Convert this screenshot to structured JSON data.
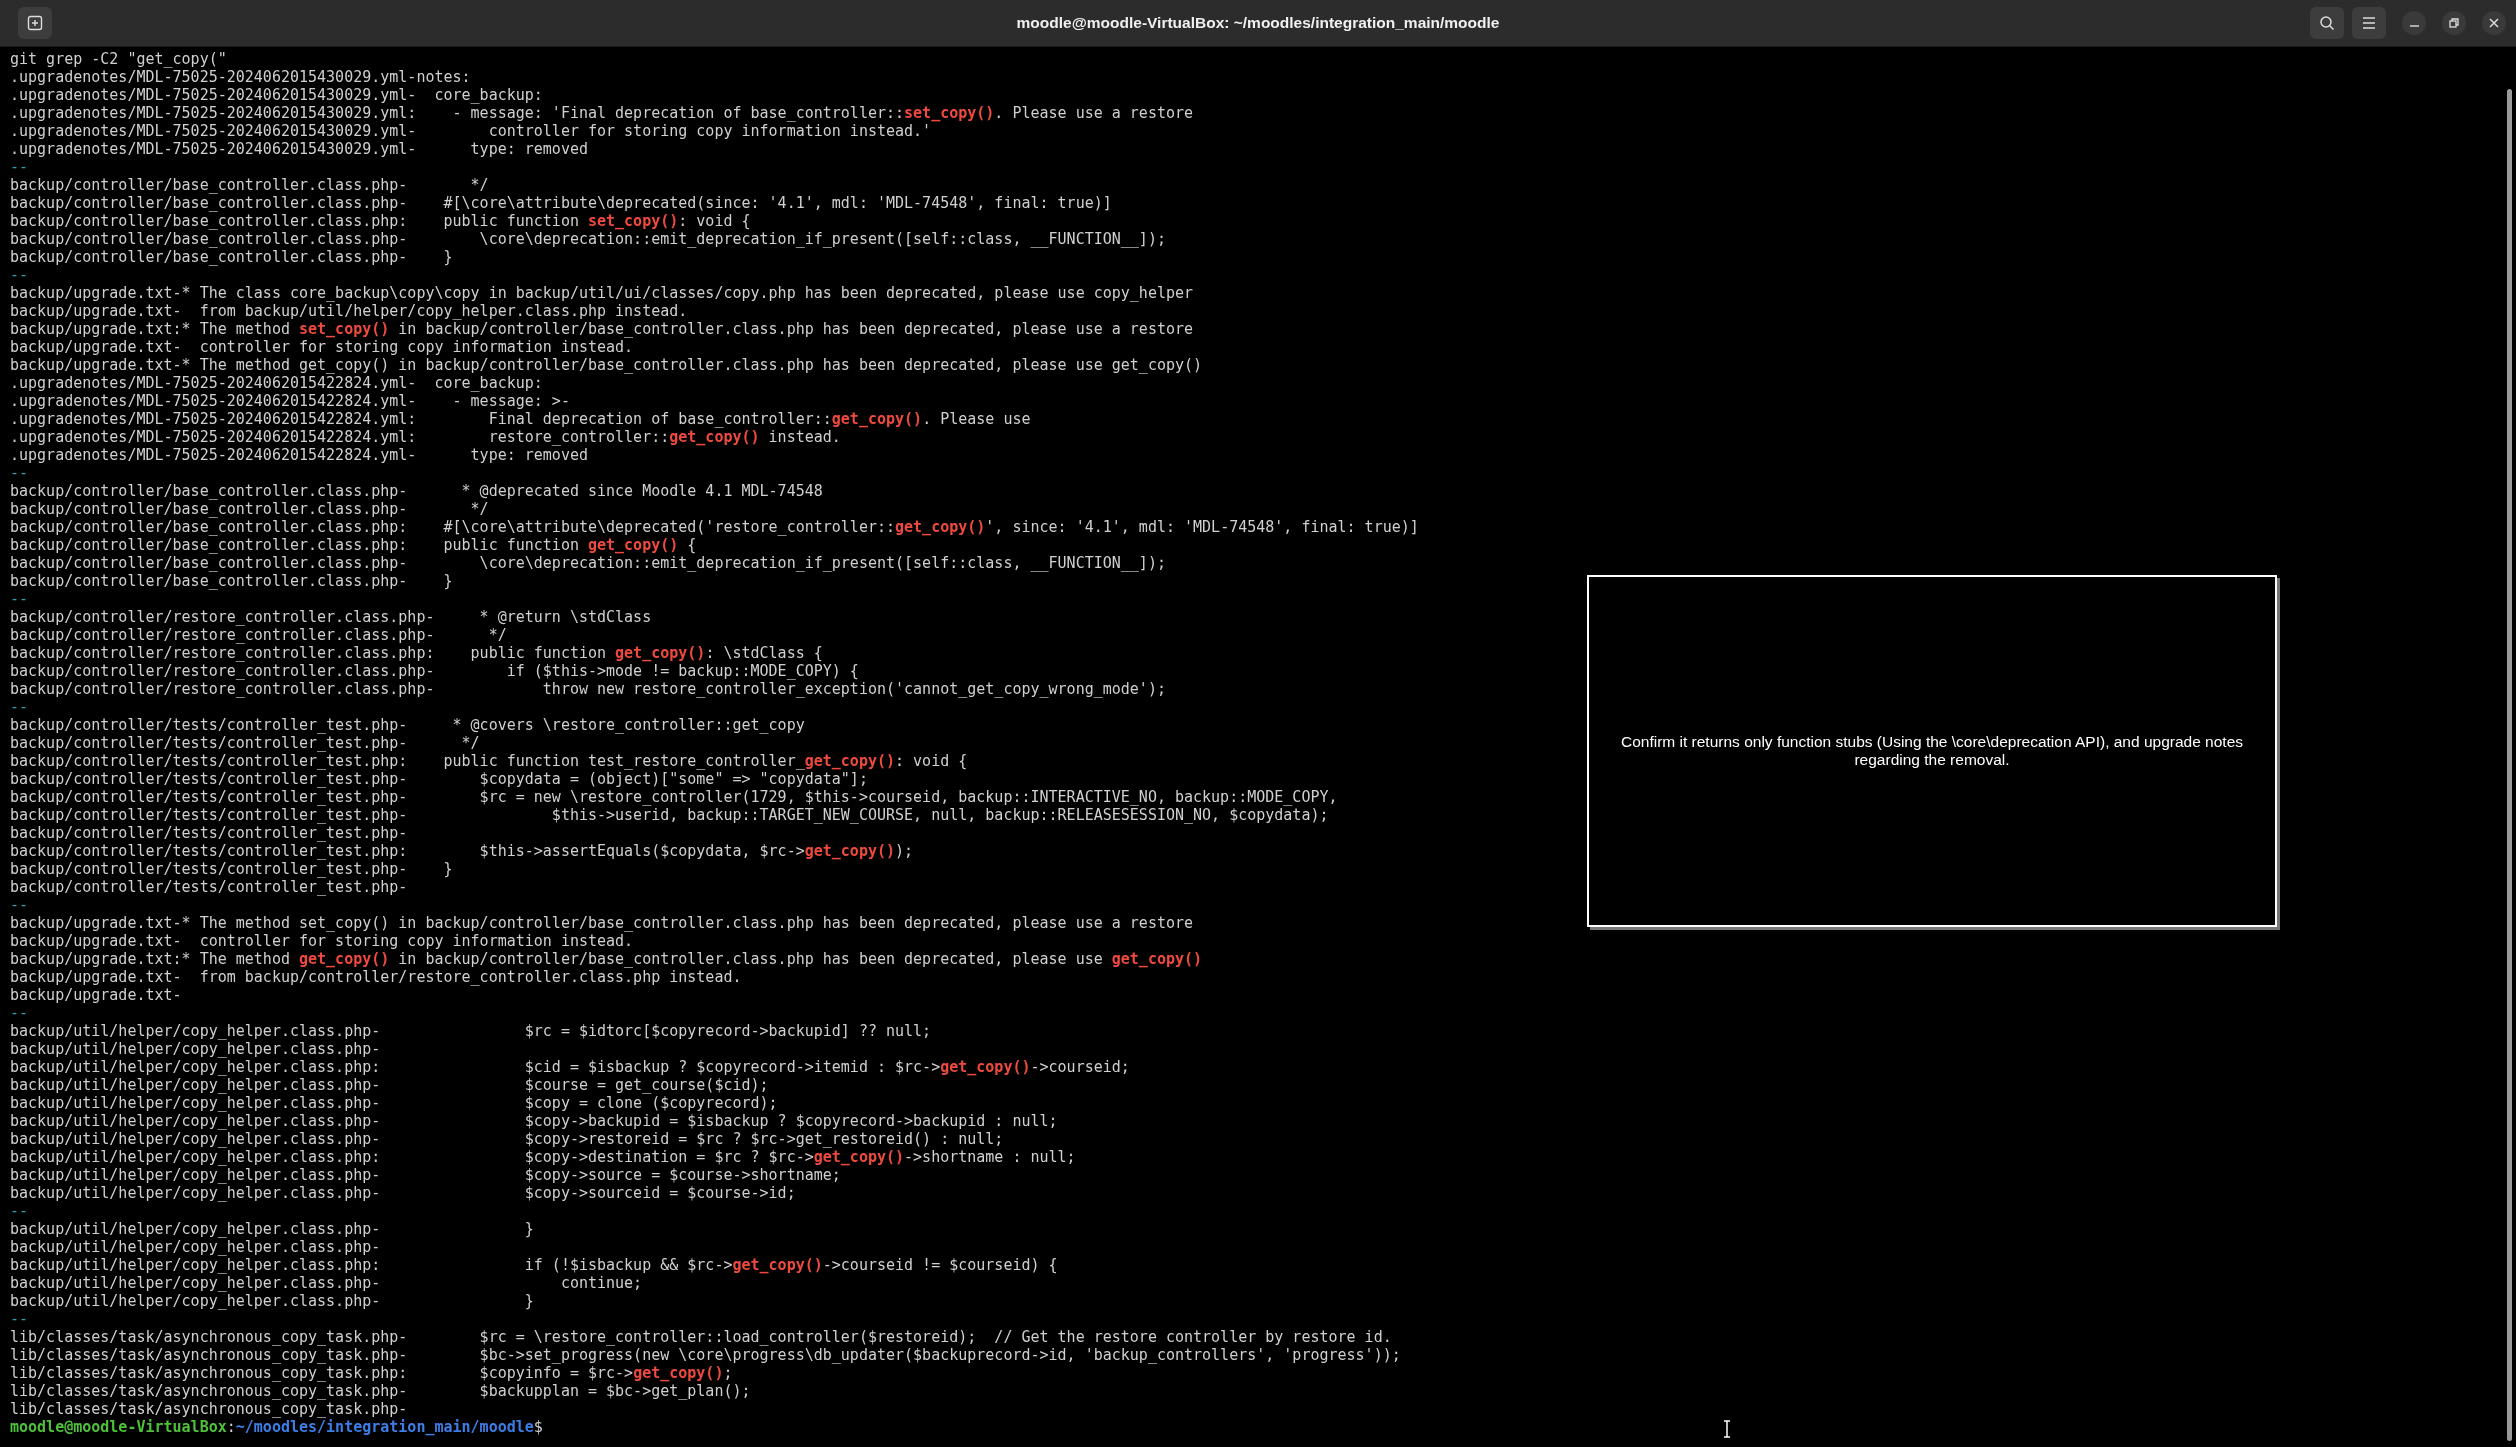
{
  "window": {
    "title": "moodle@moodle-VirtualBox: ~/moodles/integration_main/moodle"
  },
  "terminal": {
    "lines": [
      {
        "kind": "command",
        "segments": [
          {
            "kind": "plain",
            "text": "git grep -C2 \"get_copy(\""
          }
        ]
      },
      {
        "kind": "context",
        "segments": [
          {
            "kind": "plain",
            "text": ".upgradenotes/MDL-75025-2024062015430029.yml-notes:"
          }
        ]
      },
      {
        "kind": "context",
        "segments": [
          {
            "kind": "plain",
            "text": ".upgradenotes/MDL-75025-2024062015430029.yml-  core_backup:"
          }
        ]
      },
      {
        "kind": "match",
        "segments": [
          {
            "kind": "plain",
            "text": ".upgradenotes/MDL-75025-2024062015430029.yml:    - message: 'Final deprecation of base_controller::"
          },
          {
            "kind": "match",
            "text": "set_copy()"
          },
          {
            "kind": "plain",
            "text": ". Please use a restore"
          }
        ]
      },
      {
        "kind": "context",
        "segments": [
          {
            "kind": "plain",
            "text": ".upgradenotes/MDL-75025-2024062015430029.yml-        controller for storing copy information instead.'"
          }
        ]
      },
      {
        "kind": "context",
        "segments": [
          {
            "kind": "plain",
            "text": ".upgradenotes/MDL-75025-2024062015430029.yml-      type: removed"
          }
        ]
      },
      {
        "kind": "break",
        "segments": [
          {
            "kind": "plain",
            "text": "--"
          }
        ]
      },
      {
        "kind": "context",
        "segments": [
          {
            "kind": "plain",
            "text": "backup/controller/base_controller.class.php-       */"
          }
        ]
      },
      {
        "kind": "context",
        "segments": [
          {
            "kind": "plain",
            "text": "backup/controller/base_controller.class.php-    #[\\core\\attribute\\deprecated(since: '4.1', mdl: 'MDL-74548', final: true)]"
          }
        ]
      },
      {
        "kind": "match",
        "segments": [
          {
            "kind": "plain",
            "text": "backup/controller/base_controller.class.php:    public function "
          },
          {
            "kind": "match",
            "text": "set_copy()"
          },
          {
            "kind": "plain",
            "text": ": void {"
          }
        ]
      },
      {
        "kind": "context",
        "segments": [
          {
            "kind": "plain",
            "text": "backup/controller/base_controller.class.php-        \\core\\deprecation::emit_deprecation_if_present([self::class, __FUNCTION__]);"
          }
        ]
      },
      {
        "kind": "context",
        "segments": [
          {
            "kind": "plain",
            "text": "backup/controller/base_controller.class.php-    }"
          }
        ]
      },
      {
        "kind": "break",
        "segments": [
          {
            "kind": "plain",
            "text": "--"
          }
        ]
      },
      {
        "kind": "context",
        "segments": [
          {
            "kind": "plain",
            "text": "backup/upgrade.txt-* The class core_backup\\copy\\copy in backup/util/ui/classes/copy.php has been deprecated, please use copy_helper"
          }
        ]
      },
      {
        "kind": "context",
        "segments": [
          {
            "kind": "plain",
            "text": "backup/upgrade.txt-  from backup/util/helper/copy_helper.class.php instead."
          }
        ]
      },
      {
        "kind": "match",
        "segments": [
          {
            "kind": "plain",
            "text": "backup/upgrade.txt:* The method "
          },
          {
            "kind": "match",
            "text": "set_copy()"
          },
          {
            "kind": "plain",
            "text": " in backup/controller/base_controller.class.php has been deprecated, please use a restore"
          }
        ]
      },
      {
        "kind": "context",
        "segments": [
          {
            "kind": "plain",
            "text": "backup/upgrade.txt-  controller for storing copy information instead."
          }
        ]
      },
      {
        "kind": "context",
        "segments": [
          {
            "kind": "plain",
            "text": "backup/upgrade.txt-* The method get_copy() in backup/controller/base_controller.class.php has been deprecated, please use get_copy()"
          }
        ]
      },
      {
        "kind": "context",
        "segments": [
          {
            "kind": "plain",
            "text": ".upgradenotes/MDL-75025-2024062015422824.yml-  core_backup:"
          }
        ]
      },
      {
        "kind": "context",
        "segments": [
          {
            "kind": "plain",
            "text": ".upgradenotes/MDL-75025-2024062015422824.yml-    - message: >-"
          }
        ]
      },
      {
        "kind": "match",
        "segments": [
          {
            "kind": "plain",
            "text": ".upgradenotes/MDL-75025-2024062015422824.yml:        Final deprecation of base_controller::"
          },
          {
            "kind": "match",
            "text": "get_copy()"
          },
          {
            "kind": "plain",
            "text": ". Please use"
          }
        ]
      },
      {
        "kind": "match",
        "segments": [
          {
            "kind": "plain",
            "text": ".upgradenotes/MDL-75025-2024062015422824.yml:        restore_controller::"
          },
          {
            "kind": "match",
            "text": "get_copy()"
          },
          {
            "kind": "plain",
            "text": " instead."
          }
        ]
      },
      {
        "kind": "context",
        "segments": [
          {
            "kind": "plain",
            "text": ".upgradenotes/MDL-75025-2024062015422824.yml-      type: removed"
          }
        ]
      },
      {
        "kind": "break",
        "segments": [
          {
            "kind": "plain",
            "text": "--"
          }
        ]
      },
      {
        "kind": "context",
        "segments": [
          {
            "kind": "plain",
            "text": "backup/controller/base_controller.class.php-      * @deprecated since Moodle 4.1 MDL-74548"
          }
        ]
      },
      {
        "kind": "context",
        "segments": [
          {
            "kind": "plain",
            "text": "backup/controller/base_controller.class.php-       */"
          }
        ]
      },
      {
        "kind": "match",
        "segments": [
          {
            "kind": "plain",
            "text": "backup/controller/base_controller.class.php:    #[\\core\\attribute\\deprecated('restore_controller::"
          },
          {
            "kind": "match",
            "text": "get_copy()"
          },
          {
            "kind": "plain",
            "text": "', since: '4.1', mdl: 'MDL-74548', final: true)]"
          }
        ]
      },
      {
        "kind": "match",
        "segments": [
          {
            "kind": "plain",
            "text": "backup/controller/base_controller.class.php:    public function "
          },
          {
            "kind": "match",
            "text": "get_copy()"
          },
          {
            "kind": "plain",
            "text": " {"
          }
        ]
      },
      {
        "kind": "context",
        "segments": [
          {
            "kind": "plain",
            "text": "backup/controller/base_controller.class.php-        \\core\\deprecation::emit_deprecation_if_present([self::class, __FUNCTION__]);"
          }
        ]
      },
      {
        "kind": "context",
        "segments": [
          {
            "kind": "plain",
            "text": "backup/controller/base_controller.class.php-    }"
          }
        ]
      },
      {
        "kind": "break",
        "segments": [
          {
            "kind": "plain",
            "text": "--"
          }
        ]
      },
      {
        "kind": "context",
        "segments": [
          {
            "kind": "plain",
            "text": "backup/controller/restore_controller.class.php-     * @return \\stdClass"
          }
        ]
      },
      {
        "kind": "context",
        "segments": [
          {
            "kind": "plain",
            "text": "backup/controller/restore_controller.class.php-      */"
          }
        ]
      },
      {
        "kind": "match",
        "segments": [
          {
            "kind": "plain",
            "text": "backup/controller/restore_controller.class.php:    public function "
          },
          {
            "kind": "match",
            "text": "get_copy()"
          },
          {
            "kind": "plain",
            "text": ": \\stdClass {"
          }
        ]
      },
      {
        "kind": "context",
        "segments": [
          {
            "kind": "plain",
            "text": "backup/controller/restore_controller.class.php-        if ($this->mode != backup::MODE_COPY) {"
          }
        ]
      },
      {
        "kind": "context",
        "segments": [
          {
            "kind": "plain",
            "text": "backup/controller/restore_controller.class.php-            throw new restore_controller_exception('cannot_get_copy_wrong_mode');"
          }
        ]
      },
      {
        "kind": "break",
        "segments": [
          {
            "kind": "plain",
            "text": "--"
          }
        ]
      },
      {
        "kind": "context",
        "segments": [
          {
            "kind": "plain",
            "text": "backup/controller/tests/controller_test.php-     * @covers \\restore_controller::get_copy"
          }
        ]
      },
      {
        "kind": "context",
        "segments": [
          {
            "kind": "plain",
            "text": "backup/controller/tests/controller_test.php-      */"
          }
        ]
      },
      {
        "kind": "match",
        "segments": [
          {
            "kind": "plain",
            "text": "backup/controller/tests/controller_test.php:    public function test_restore_controller_"
          },
          {
            "kind": "match",
            "text": "get_copy()"
          },
          {
            "kind": "plain",
            "text": ": void {"
          }
        ]
      },
      {
        "kind": "context",
        "segments": [
          {
            "kind": "plain",
            "text": "backup/controller/tests/controller_test.php-        $copydata = (object)[\"some\" => \"copydata\"];"
          }
        ]
      },
      {
        "kind": "context",
        "segments": [
          {
            "kind": "plain",
            "text": "backup/controller/tests/controller_test.php-        $rc = new \\restore_controller(1729, $this->courseid, backup::INTERACTIVE_NO, backup::MODE_COPY,"
          }
        ]
      },
      {
        "kind": "context",
        "segments": [
          {
            "kind": "plain",
            "text": "backup/controller/tests/controller_test.php-                $this->userid, backup::TARGET_NEW_COURSE, null, backup::RELEASESESSION_NO, $copydata);"
          }
        ]
      },
      {
        "kind": "context",
        "segments": [
          {
            "kind": "plain",
            "text": "backup/controller/tests/controller_test.php-"
          }
        ]
      },
      {
        "kind": "match",
        "segments": [
          {
            "kind": "plain",
            "text": "backup/controller/tests/controller_test.php:        $this->assertEquals($copydata, $rc->"
          },
          {
            "kind": "match",
            "text": "get_copy()"
          },
          {
            "kind": "plain",
            "text": ");"
          }
        ]
      },
      {
        "kind": "context",
        "segments": [
          {
            "kind": "plain",
            "text": "backup/controller/tests/controller_test.php-    }"
          }
        ]
      },
      {
        "kind": "context",
        "segments": [
          {
            "kind": "plain",
            "text": "backup/controller/tests/controller_test.php-"
          }
        ]
      },
      {
        "kind": "break",
        "segments": [
          {
            "kind": "plain",
            "text": "--"
          }
        ]
      },
      {
        "kind": "context",
        "segments": [
          {
            "kind": "plain",
            "text": "backup/upgrade.txt-* The method set_copy() in backup/controller/base_controller.class.php has been deprecated, please use a restore"
          }
        ]
      },
      {
        "kind": "context",
        "segments": [
          {
            "kind": "plain",
            "text": "backup/upgrade.txt-  controller for storing copy information instead."
          }
        ]
      },
      {
        "kind": "match",
        "segments": [
          {
            "kind": "plain",
            "text": "backup/upgrade.txt:* The method "
          },
          {
            "kind": "match",
            "text": "get_copy()"
          },
          {
            "kind": "plain",
            "text": " in backup/controller/base_controller.class.php has been deprecated, please use "
          },
          {
            "kind": "match",
            "text": "get_copy()"
          }
        ]
      },
      {
        "kind": "context",
        "segments": [
          {
            "kind": "plain",
            "text": "backup/upgrade.txt-  from backup/controller/restore_controller.class.php instead."
          }
        ]
      },
      {
        "kind": "context",
        "segments": [
          {
            "kind": "plain",
            "text": "backup/upgrade.txt-"
          }
        ]
      },
      {
        "kind": "break",
        "segments": [
          {
            "kind": "plain",
            "text": "--"
          }
        ]
      },
      {
        "kind": "context",
        "segments": [
          {
            "kind": "plain",
            "text": "backup/util/helper/copy_helper.class.php-                $rc = $idtorc[$copyrecord->backupid] ?? null;"
          }
        ]
      },
      {
        "kind": "context",
        "segments": [
          {
            "kind": "plain",
            "text": "backup/util/helper/copy_helper.class.php-"
          }
        ]
      },
      {
        "kind": "match",
        "segments": [
          {
            "kind": "plain",
            "text": "backup/util/helper/copy_helper.class.php:                $cid = $isbackup ? $copyrecord->itemid : $rc->"
          },
          {
            "kind": "match",
            "text": "get_copy()"
          },
          {
            "kind": "plain",
            "text": "->courseid;"
          }
        ]
      },
      {
        "kind": "context",
        "segments": [
          {
            "kind": "plain",
            "text": "backup/util/helper/copy_helper.class.php-                $course = get_course($cid);"
          }
        ]
      },
      {
        "kind": "context",
        "segments": [
          {
            "kind": "plain",
            "text": "backup/util/helper/copy_helper.class.php-                $copy = clone ($copyrecord);"
          }
        ]
      },
      {
        "kind": "context",
        "segments": [
          {
            "kind": "plain",
            "text": "backup/util/helper/copy_helper.class.php-                $copy->backupid = $isbackup ? $copyrecord->backupid : null;"
          }
        ]
      },
      {
        "kind": "context",
        "segments": [
          {
            "kind": "plain",
            "text": "backup/util/helper/copy_helper.class.php-                $copy->restoreid = $rc ? $rc->get_restoreid() : null;"
          }
        ]
      },
      {
        "kind": "match",
        "segments": [
          {
            "kind": "plain",
            "text": "backup/util/helper/copy_helper.class.php:                $copy->destination = $rc ? $rc->"
          },
          {
            "kind": "match",
            "text": "get_copy()"
          },
          {
            "kind": "plain",
            "text": "->shortname : null;"
          }
        ]
      },
      {
        "kind": "context",
        "segments": [
          {
            "kind": "plain",
            "text": "backup/util/helper/copy_helper.class.php-                $copy->source = $course->shortname;"
          }
        ]
      },
      {
        "kind": "context",
        "segments": [
          {
            "kind": "plain",
            "text": "backup/util/helper/copy_helper.class.php-                $copy->sourceid = $course->id;"
          }
        ]
      },
      {
        "kind": "break",
        "segments": [
          {
            "kind": "plain",
            "text": "--"
          }
        ]
      },
      {
        "kind": "context",
        "segments": [
          {
            "kind": "plain",
            "text": "backup/util/helper/copy_helper.class.php-                }"
          }
        ]
      },
      {
        "kind": "context",
        "segments": [
          {
            "kind": "plain",
            "text": "backup/util/helper/copy_helper.class.php-"
          }
        ]
      },
      {
        "kind": "match",
        "segments": [
          {
            "kind": "plain",
            "text": "backup/util/helper/copy_helper.class.php:                if (!$isbackup && $rc->"
          },
          {
            "kind": "match",
            "text": "get_copy()"
          },
          {
            "kind": "plain",
            "text": "->courseid != $courseid) {"
          }
        ]
      },
      {
        "kind": "context",
        "segments": [
          {
            "kind": "plain",
            "text": "backup/util/helper/copy_helper.class.php-                    continue;"
          }
        ]
      },
      {
        "kind": "context",
        "segments": [
          {
            "kind": "plain",
            "text": "backup/util/helper/copy_helper.class.php-                }"
          }
        ]
      },
      {
        "kind": "break",
        "segments": [
          {
            "kind": "plain",
            "text": "--"
          }
        ]
      },
      {
        "kind": "context",
        "segments": [
          {
            "kind": "plain",
            "text": "lib/classes/task/asynchronous_copy_task.php-        $rc = \\restore_controller::load_controller($restoreid);  // Get the restore controller by restore id."
          }
        ]
      },
      {
        "kind": "context",
        "segments": [
          {
            "kind": "plain",
            "text": "lib/classes/task/asynchronous_copy_task.php-        $bc->set_progress(new \\core\\progress\\db_updater($backuprecord->id, 'backup_controllers', 'progress'));"
          }
        ]
      },
      {
        "kind": "match",
        "segments": [
          {
            "kind": "plain",
            "text": "lib/classes/task/asynchronous_copy_task.php:        $copyinfo = $rc->"
          },
          {
            "kind": "match",
            "text": "get_copy()"
          },
          {
            "kind": "plain",
            "text": ";"
          }
        ]
      },
      {
        "kind": "context",
        "segments": [
          {
            "kind": "plain",
            "text": "lib/classes/task/asynchronous_copy_task.php-        $backupplan = $bc->get_plan();"
          }
        ]
      },
      {
        "kind": "context",
        "segments": [
          {
            "kind": "plain",
            "text": "lib/classes/task/asynchronous_copy_task.php-"
          }
        ]
      },
      {
        "kind": "prompt",
        "segments": [
          {
            "kind": "user",
            "text": "moodle@moodle-VirtualBox"
          },
          {
            "kind": "plain",
            "text": ":"
          },
          {
            "kind": "path",
            "text": "~/moodles/integration_main/moodle"
          },
          {
            "kind": "plain",
            "text": "$"
          }
        ]
      }
    ]
  },
  "note": {
    "text": "Confirm it returns only function stubs (Using the \\core\\deprecation API), and upgrade notes regarding the removal."
  }
}
